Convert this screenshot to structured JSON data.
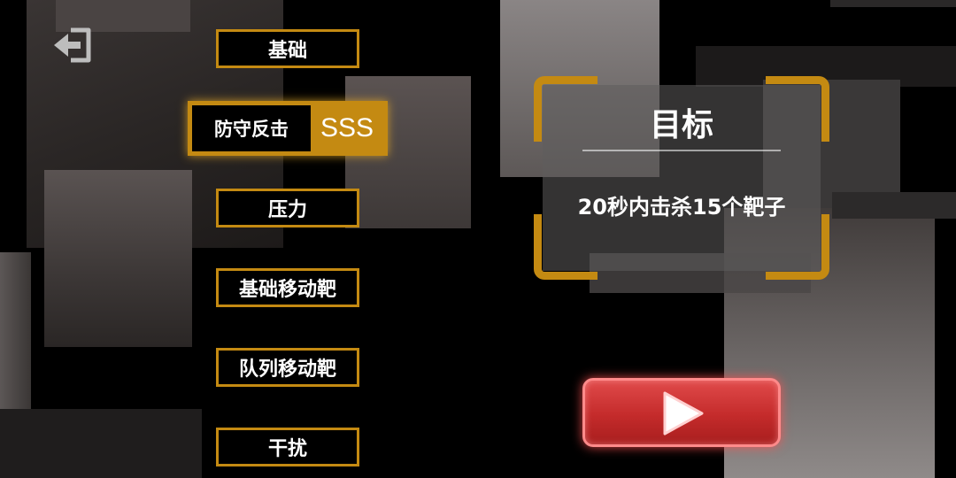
{
  "menu": {
    "items": [
      {
        "label": "基础"
      },
      {
        "label": "防守反击",
        "grade": "SSS",
        "selected": true
      },
      {
        "label": "压力"
      },
      {
        "label": "基础移动靶"
      },
      {
        "label": "队列移动靶"
      },
      {
        "label": "干扰"
      }
    ]
  },
  "target": {
    "title": "目标",
    "description": "20秒内击杀15个靶子"
  },
  "icons": {
    "exit": "exit-icon",
    "play": "play-icon"
  },
  "colors": {
    "accent_gold": "#c48a12",
    "play_red": "#c42b2b",
    "background": "#000000"
  }
}
